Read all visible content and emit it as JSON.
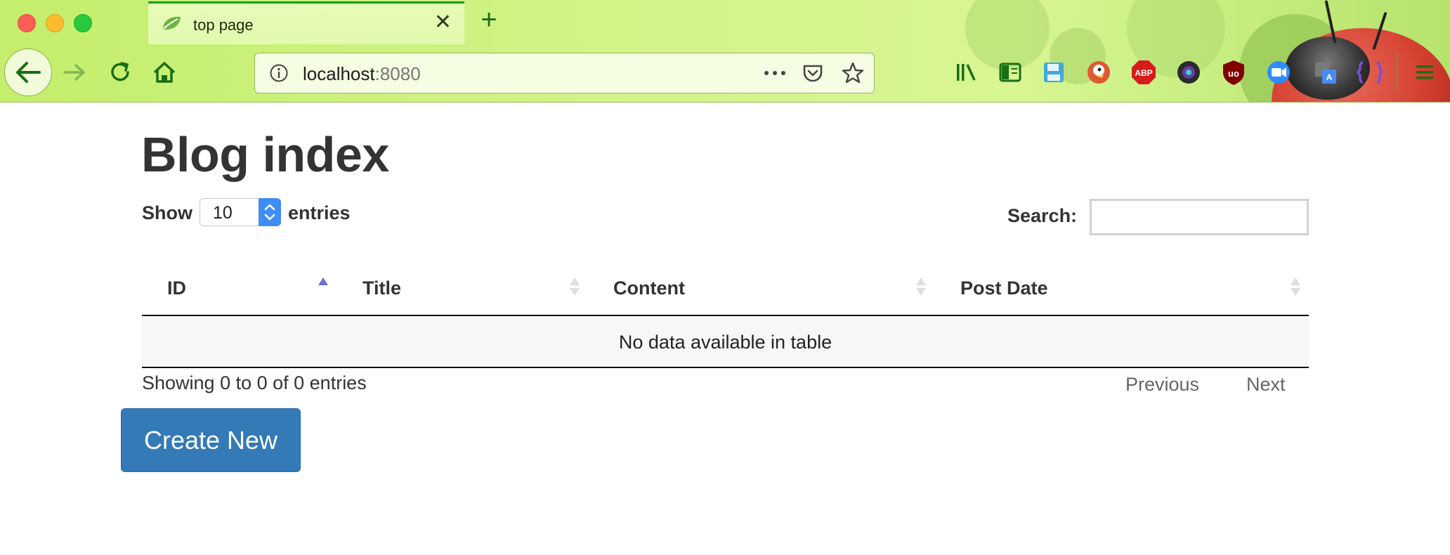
{
  "browser": {
    "tab_title": "top page",
    "url_host": "localhost",
    "url_port": ":8080",
    "icons": [
      "back-icon",
      "forward-icon",
      "reload-icon",
      "home-icon",
      "info-icon",
      "more-icon",
      "pocket-icon",
      "bookmark-star-icon",
      "library-icon",
      "sidebar-icon",
      "save-icon",
      "duckduckgo-icon",
      "adblock-plus-icon",
      "camera-icon",
      "ublock-icon",
      "zoom-icon",
      "translate-icon",
      "extension-icon",
      "menu-icon"
    ],
    "ext_labels": {
      "abp": "ABP",
      "ublock": "uo"
    }
  },
  "page": {
    "title": "Blog index",
    "length": {
      "show": "Show",
      "value": "10",
      "entries": "entries"
    },
    "search": {
      "label": "Search:",
      "value": ""
    },
    "table": {
      "columns": [
        "ID",
        "Title",
        "Content",
        "Post Date"
      ],
      "empty_message": "No data available in table"
    },
    "info": "Showing 0 to 0 of 0 entries",
    "pagination": {
      "previous": "Previous",
      "next": "Next"
    },
    "create_button": "Create New"
  },
  "colors": {
    "accent_green": "#16a01c",
    "primary_button": "#337ab7",
    "select_arrow": "#3f8cf6"
  }
}
